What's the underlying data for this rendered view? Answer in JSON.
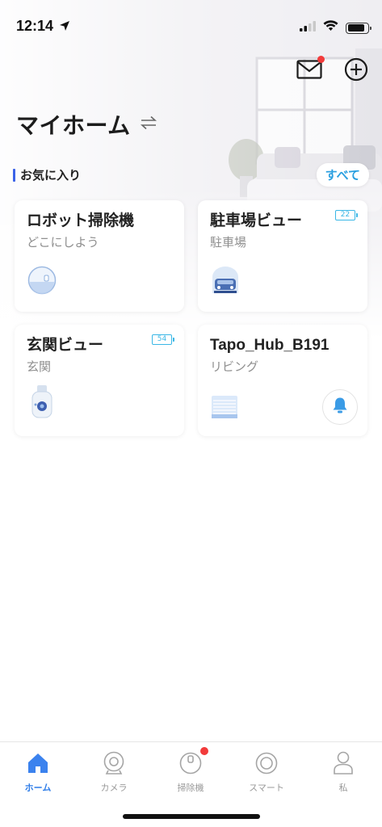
{
  "status_bar": {
    "time": "12:14",
    "icons": [
      "location-arrow-icon",
      "cellular-signal-icon",
      "wifi-icon",
      "battery-icon"
    ]
  },
  "header": {
    "title": "マイホーム",
    "switch_icon": "switch-home-icon",
    "actions": [
      "mail-icon",
      "add-icon"
    ],
    "mail_has_notification": true
  },
  "favorites": {
    "label": "お気に入り",
    "see_all": "すべて",
    "devices": [
      {
        "name": "ロボット掃除機",
        "room": "どこにしよう",
        "icon": "robot-vacuum-icon"
      },
      {
        "name": "駐車場ビュー",
        "room": "駐車場",
        "icon": "garage-camera-icon",
        "battery": "22"
      },
      {
        "name": "玄関ビュー",
        "room": "玄関",
        "icon": "battery-camera-icon",
        "battery": "54"
      },
      {
        "name": "Tapo_Hub_B191",
        "room": "リビング",
        "icon": "hub-icon",
        "action_icon": "bell-icon"
      }
    ]
  },
  "bottom_nav": {
    "items": [
      {
        "label": "ホーム",
        "icon": "home-icon",
        "active": true
      },
      {
        "label": "カメラ",
        "icon": "camera-icon",
        "active": false
      },
      {
        "label": "掃除機",
        "icon": "vacuum-icon",
        "active": false,
        "has_notification": true
      },
      {
        "label": "スマート",
        "icon": "smart-icon",
        "active": false
      },
      {
        "label": "私",
        "icon": "profile-icon",
        "active": false
      }
    ]
  },
  "colors": {
    "accent": "#2f7de8",
    "see_all": "#2a9fe0",
    "favorites_bar": "#3b63e8",
    "notification": "#f23b3b",
    "battery_badge": "#3ab7e6"
  }
}
